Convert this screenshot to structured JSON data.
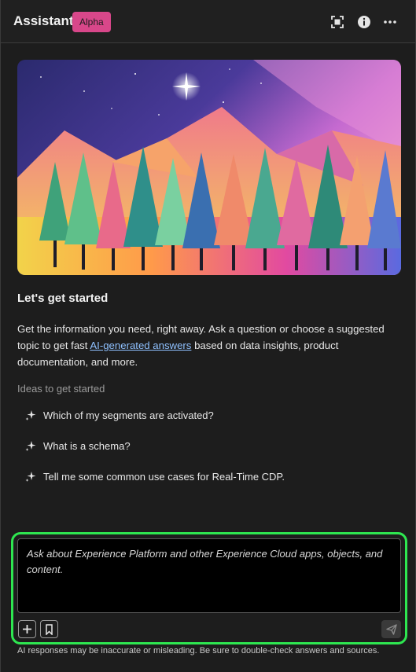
{
  "header": {
    "title": "Assistant",
    "badge": "Alpha",
    "icons": [
      "expand-icon",
      "info-icon",
      "more-icon"
    ]
  },
  "main": {
    "heading": "Let's get started",
    "intro_before": "Get the information you need, right away. Ask a question or choose a suggested topic to get fast ",
    "intro_link": "AI-generated answers",
    "intro_after": " based on data insights, product documentation, and more.",
    "ideas_title": "Ideas to get started",
    "ideas": [
      "Which of my segments are activated?",
      "What is a schema?",
      "Tell me some common use cases for Real-Time CDP."
    ]
  },
  "composer": {
    "placeholder": "Ask about Experience Platform and other Experience Cloud apps, objects, and content.",
    "disclaimer": "AI responses may be inaccurate or misleading. Be sure to double-check answers and sources."
  },
  "colors": {
    "badge": "#d8478a",
    "focus_ring": "#2ee650",
    "link": "#8fc1ff"
  }
}
